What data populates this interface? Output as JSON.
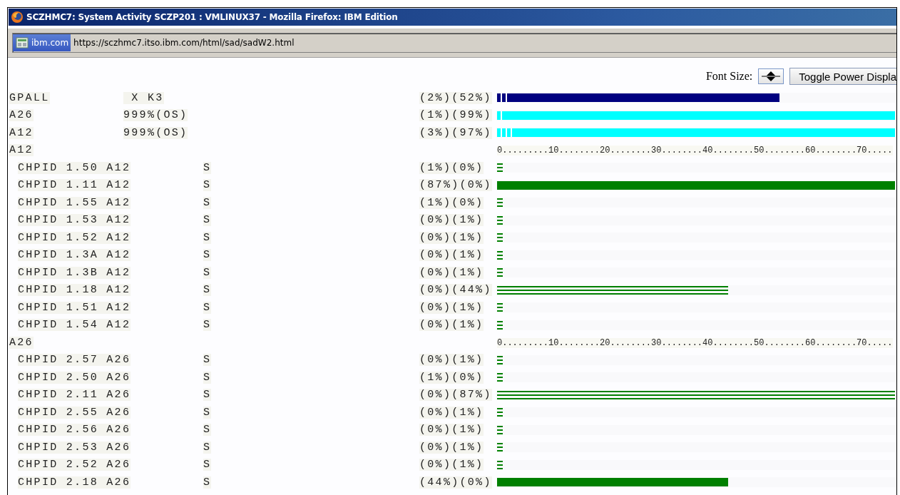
{
  "window": {
    "title": "SCZHMC7: System Activity SCZP201 : VMLINUX37 - Mozilla Firefox: IBM Edition"
  },
  "address_bar": {
    "site": "ibm.com",
    "url": "https://sczhmc7.itso.ibm.com/html/sad/sadW2.html"
  },
  "toolbar": {
    "font_size_label": "Font Size:",
    "toggle_button": "Toggle Power Displa"
  },
  "rows": [
    {
      "kind": "summary",
      "name": "GPALL",
      "info": " X K3",
      "values": "(2%)(52%)",
      "color": "#000080",
      "fills": [
        {
          "kind": "solid",
          "level": 0.71
        },
        {
          "kind": "vstripe",
          "level": 0.03
        }
      ]
    },
    {
      "kind": "summary",
      "name": "A26",
      "info": "999%(OS)",
      "values": "(1%)(99%)",
      "color": "#00ffff",
      "fills": [
        {
          "kind": "solid",
          "level": 1
        },
        {
          "kind": "vstripe",
          "level": 0.013
        }
      ]
    },
    {
      "kind": "summary",
      "name": "A12",
      "info": "999%(OS)",
      "values": "(3%)(97%)",
      "color": "#00ffff",
      "fills": [
        {
          "kind": "solid",
          "level": 1
        },
        {
          "kind": "vstripe",
          "level": 0.04
        }
      ]
    },
    {
      "kind": "group",
      "name": "A12",
      "ruler": "0.........10........20........30........40........50........60........70....."
    },
    {
      "kind": "channel",
      "name": "CHPID 1.50 A12",
      "flag": "S",
      "values": "(1%)(0%)",
      "color": "#008000",
      "fills": [
        {
          "kind": "hstripe",
          "level": 0.015
        }
      ]
    },
    {
      "kind": "channel",
      "name": "CHPID 1.11 A12",
      "flag": "S",
      "values": "(87%)(0%)",
      "color": "#008000",
      "fills": [
        {
          "kind": "solid",
          "level": 1
        }
      ]
    },
    {
      "kind": "channel",
      "name": "CHPID 1.55 A12",
      "flag": "S",
      "values": "(1%)(0%)",
      "color": "#008000",
      "fills": [
        {
          "kind": "hstripe",
          "level": 0.015
        }
      ]
    },
    {
      "kind": "channel",
      "name": "CHPID 1.53 A12",
      "flag": "S",
      "values": "(0%)(1%)",
      "color": "#008000",
      "fills": [
        {
          "kind": "hstripe",
          "level": 0.015
        }
      ]
    },
    {
      "kind": "channel",
      "name": "CHPID 1.52 A12",
      "flag": "S",
      "values": "(0%)(1%)",
      "color": "#008000",
      "fills": [
        {
          "kind": "hstripe",
          "level": 0.015
        }
      ]
    },
    {
      "kind": "channel",
      "name": "CHPID 1.3A A12",
      "flag": "S",
      "values": "(0%)(1%)",
      "color": "#008000",
      "fills": [
        {
          "kind": "hstripe",
          "level": 0.015
        }
      ]
    },
    {
      "kind": "channel",
      "name": "CHPID 1.3B A12",
      "flag": "S",
      "values": "(0%)(1%)",
      "color": "#008000",
      "fills": [
        {
          "kind": "hstripe",
          "level": 0.015
        }
      ]
    },
    {
      "kind": "channel",
      "name": "CHPID 1.18 A12",
      "flag": "S",
      "values": "(0%)(44%)",
      "color": "#008000",
      "fills": [
        {
          "kind": "hstripe",
          "level": 0.58
        }
      ]
    },
    {
      "kind": "channel",
      "name": "CHPID 1.51 A12",
      "flag": "S",
      "values": "(0%)(1%)",
      "color": "#008000",
      "fills": [
        {
          "kind": "hstripe",
          "level": 0.015
        }
      ]
    },
    {
      "kind": "channel",
      "name": "CHPID 1.54 A12",
      "flag": "S",
      "values": "(0%)(1%)",
      "color": "#008000",
      "fills": [
        {
          "kind": "hstripe",
          "level": 0.015
        }
      ]
    },
    {
      "kind": "group",
      "name": "A26",
      "ruler": "0.........10........20........30........40........50........60........70....."
    },
    {
      "kind": "channel",
      "name": "CHPID 2.57 A26",
      "flag": "S",
      "values": "(0%)(1%)",
      "color": "#008000",
      "fills": [
        {
          "kind": "hstripe",
          "level": 0.015
        }
      ]
    },
    {
      "kind": "channel",
      "name": "CHPID 2.50 A26",
      "flag": "S",
      "values": "(1%)(0%)",
      "color": "#008000",
      "fills": [
        {
          "kind": "hstripe",
          "level": 0.015
        }
      ]
    },
    {
      "kind": "channel",
      "name": "CHPID 2.11 A26",
      "flag": "S",
      "values": "(0%)(87%)",
      "color": "#008000",
      "fills": [
        {
          "kind": "hstripe",
          "level": 1
        }
      ]
    },
    {
      "kind": "channel",
      "name": "CHPID 2.55 A26",
      "flag": "S",
      "values": "(0%)(1%)",
      "color": "#008000",
      "fills": [
        {
          "kind": "hstripe",
          "level": 0.015
        }
      ]
    },
    {
      "kind": "channel",
      "name": "CHPID 2.56 A26",
      "flag": "S",
      "values": "(0%)(1%)",
      "color": "#008000",
      "fills": [
        {
          "kind": "hstripe",
          "level": 0.015
        }
      ]
    },
    {
      "kind": "channel",
      "name": "CHPID 2.53 A26",
      "flag": "S",
      "values": "(0%)(1%)",
      "color": "#008000",
      "fills": [
        {
          "kind": "hstripe",
          "level": 0.015
        }
      ]
    },
    {
      "kind": "channel",
      "name": "CHPID 2.52 A26",
      "flag": "S",
      "values": "(0%)(1%)",
      "color": "#008000",
      "fills": [
        {
          "kind": "hstripe",
          "level": 0.015
        }
      ]
    },
    {
      "kind": "channel",
      "name": "CHPID 2.18 A26",
      "flag": "S",
      "values": "(44%)(0%)",
      "color": "#008000",
      "fills": [
        {
          "kind": "solid",
          "level": 0.58
        }
      ]
    }
  ]
}
